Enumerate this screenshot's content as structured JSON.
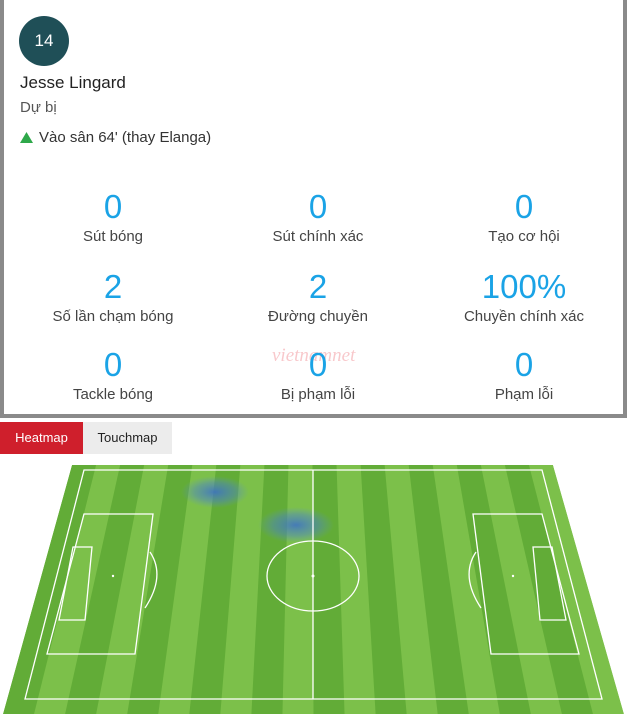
{
  "player": {
    "number": "14",
    "name": "Jesse Lingard",
    "role": "Dự bị",
    "sub_in": "Vào sân 64' (thay Elanga)"
  },
  "stats": [
    {
      "value": "0",
      "label": "Sút bóng"
    },
    {
      "value": "0",
      "label": "Sút chính xác"
    },
    {
      "value": "0",
      "label": "Tạo cơ hội"
    },
    {
      "value": "2",
      "label": "Số lần chạm bóng"
    },
    {
      "value": "2",
      "label": "Đường chuyền"
    },
    {
      "value": "100%",
      "label": "Chuyền chính xác"
    },
    {
      "value": "0",
      "label": "Tackle bóng"
    },
    {
      "value": "0",
      "label": "Bị phạm lỗi"
    },
    {
      "value": "0",
      "label": "Phạm lỗi"
    }
  ],
  "watermark": "vietnamnet",
  "tabs": {
    "heatmap": "Heatmap",
    "touchmap": "Touchmap"
  },
  "colors": {
    "accent": "#1aa3e6",
    "tab_active": "#cf1f2c",
    "badge": "#1f4f57",
    "pitch_light": "#7cc04a",
    "pitch_dark": "#62ac37",
    "up_arrow": "#2ea84a"
  },
  "icons": {
    "sub_icon": "triangle-up-icon"
  }
}
